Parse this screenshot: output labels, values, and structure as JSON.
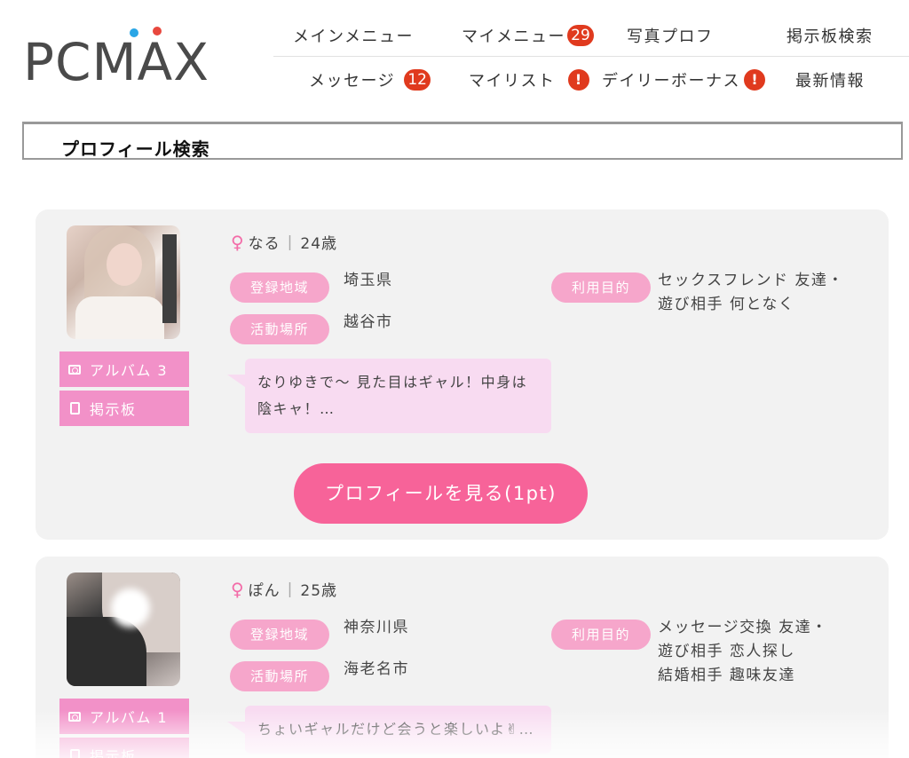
{
  "logo": {
    "text": "PCMAX"
  },
  "nav": {
    "top": [
      {
        "label": "メインメニュー"
      },
      {
        "label": "マイメニュー",
        "badge": "29"
      },
      {
        "label": "写真プロフ"
      },
      {
        "label": "掲示板検索"
      }
    ],
    "bottom": [
      {
        "label": "メッセージ",
        "badge": "12"
      },
      {
        "label": "マイリスト",
        "alert": "!"
      },
      {
        "label": "デイリーボーナス",
        "alert": "!"
      },
      {
        "label": "最新情報"
      }
    ]
  },
  "section_title": "プロフィール検索",
  "labels": {
    "region": "登録地域",
    "activity": "活動場所",
    "purpose": "利用目的",
    "bbs": "掲示板",
    "view_profile": "プロフィールを見る(1pt)"
  },
  "profiles": [
    {
      "name": "なる",
      "age": "24歳",
      "album": "アルバム 3",
      "region": "埼玉県",
      "activity": "越谷市",
      "purpose_line1": "セックスフレンド 友達・",
      "purpose_line2": "遊び相手 何となく",
      "message": "なりゆきで〜 見た目はギャル！中身は陰キャ！…"
    },
    {
      "name": "ぽん",
      "age": "25歳",
      "album": "アルバム 1",
      "region": "神奈川県",
      "activity": "海老名市",
      "purpose_line1": "メッセージ交換 友達・",
      "purpose_line2": "遊び相手 恋人探し",
      "purpose_line3": "結婚相手 趣味友達",
      "message": "ちょいギャルだけど会うと楽しいよ✌…"
    }
  ],
  "colors": {
    "accent_pink": "#f76399",
    "pill_pink": "#f6a6cb",
    "side_button_pink": "#f291c8",
    "bubble_pink": "#f8dbf1",
    "badge_red": "#e03a1e",
    "card_gray": "#f2f2f2"
  }
}
